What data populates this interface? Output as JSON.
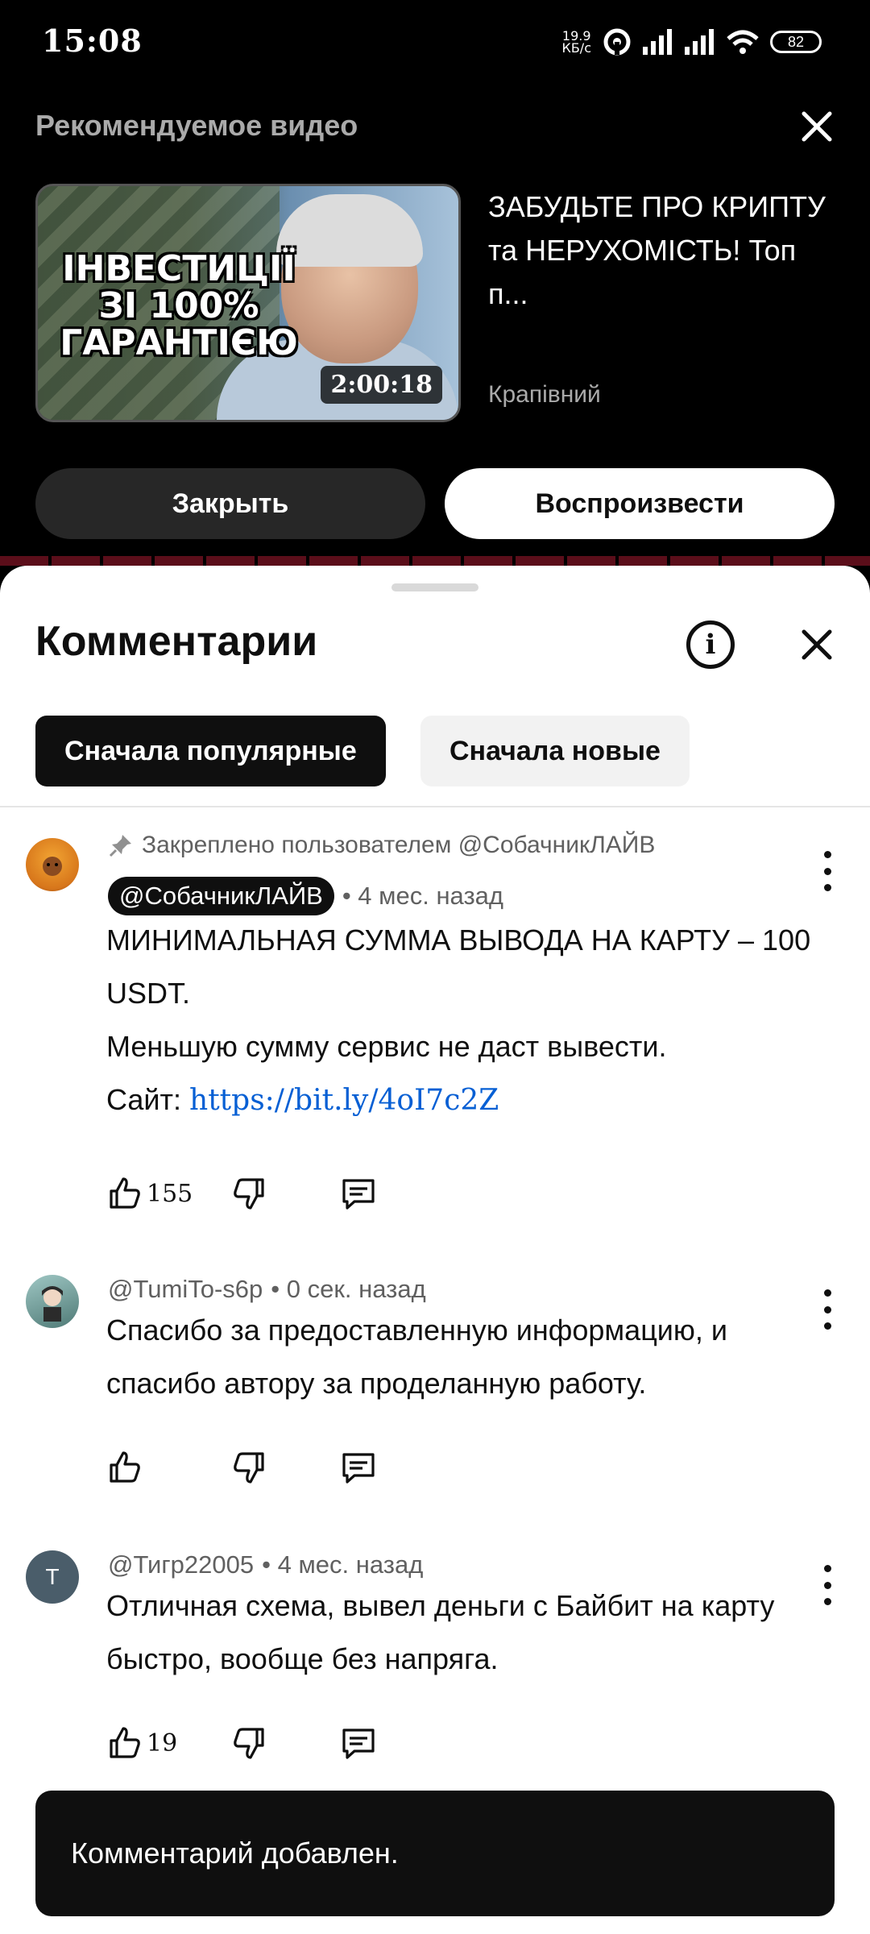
{
  "status_bar": {
    "time": "15:08",
    "net_speed_value": "19.9",
    "net_speed_unit": "КБ/с",
    "battery": "82"
  },
  "recommended": {
    "header": "Рекомендуемое видео",
    "thumbnail_text": "ІНВЕСТИЦІЇ ЗІ 100% ГАРАНТІЄЮ",
    "duration": "2:00:18",
    "video_title": "ЗАБУДЬТЕ ПРО КРИПТУ та НЕРУХОМІСТЬ! Топ п...",
    "channel": "Крапівний",
    "close_label": "Закрыть",
    "play_label": "Воспроизвести"
  },
  "comments_sheet": {
    "title": "Комментарии",
    "sort_chips": [
      {
        "label": "Сначала популярные",
        "active": true
      },
      {
        "label": "Сначала новые",
        "active": false
      }
    ],
    "comments": [
      {
        "pinned_text": "Закреплено пользователем @СобачникЛАЙВ",
        "author": "@СобачникЛАЙВ",
        "time": "• 4 мес. назад",
        "text_line1": "МИНИМАЛЬНАЯ СУММА ВЫВОДА НА КАРТУ – 100 USDT.",
        "text_line2": "Меньшую сумму сервис не даст вывести.",
        "text_line3_prefix": "Сайт: ",
        "link": "https://bit.ly/4oI7c2Z",
        "likes": "155"
      },
      {
        "author": "@TumiTo-s6p",
        "time": "• 0 сек. назад",
        "text": "Спасибо за предоставленную информацию, и спасибо автору за проделанную работу.",
        "likes": ""
      },
      {
        "author": "@Тигр22005",
        "avatar_letter": "Т",
        "time": "• 4 мес. назад",
        "text": "Отличная схема, вывел деньги с Байбит на карту быстро, вообще без напряга.",
        "likes": "19"
      }
    ]
  },
  "snackbar": {
    "message": "Комментарий добавлен."
  },
  "colors": {
    "link": "#065fd4",
    "active_chip": "#0f0f0f",
    "inactive_chip": "#f2f2f2",
    "secondary_text": "#606060"
  }
}
